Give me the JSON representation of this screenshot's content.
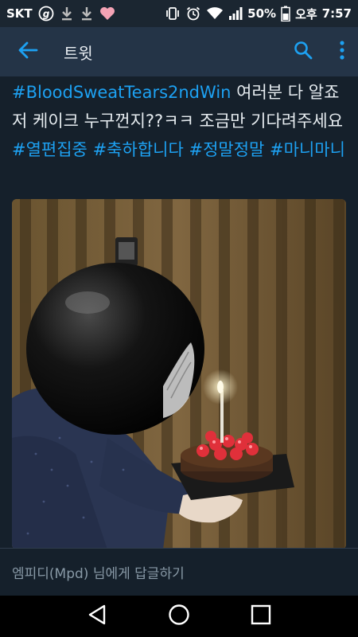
{
  "status_bar": {
    "carrier": "SKT",
    "battery": "50%",
    "ampm": "오후",
    "time": "7:57",
    "icons": [
      "g-circle-icon",
      "download-icon",
      "download-icon",
      "heart-icon",
      "vibrate-icon",
      "alarm-icon",
      "wifi-icon",
      "signal-icon",
      "battery-icon"
    ]
  },
  "app_bar": {
    "title": "트윗",
    "icons": [
      "back-arrow-icon",
      "search-icon",
      "more-vertical-icon"
    ],
    "accent": "#1da1f2"
  },
  "tweet": {
    "tag_1": "#BloodSweatTears2ndWin",
    "text_1": " 여러분 다 알죠 저 케이크 누구껀지??ㅋㅋ 조금만 기다려주세요 ",
    "tag_2": "#열편집중",
    "tag_3": "#축하합니다",
    "tag_4": "#정말정말",
    "tag_5": "#마니마니"
  },
  "reply": {
    "placeholder": "엠피디(Mpd) 님에게 답글하기"
  },
  "nav_bar": {
    "icons": [
      "back-triangle-icon",
      "home-circle-icon",
      "recents-square-icon"
    ]
  }
}
